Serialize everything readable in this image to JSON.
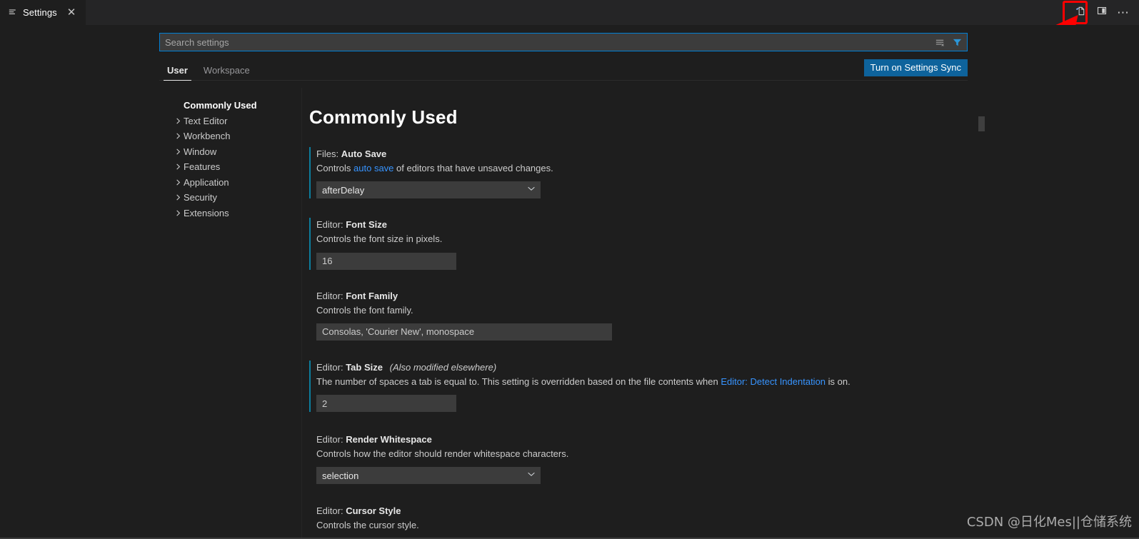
{
  "window": {
    "tab": {
      "title": "Settings",
      "icon": "settings-list-icon",
      "close_label": "✕"
    },
    "actions": [
      {
        "name": "open-settings-json-button",
        "icon": "file-json-icon",
        "label": ""
      },
      {
        "name": "split-editor-button",
        "icon": "split-editor-icon",
        "label": ""
      },
      {
        "name": "more-actions-button",
        "icon": "ellipsis-icon",
        "label": "⋯"
      }
    ]
  },
  "annotation": {
    "box_color": "#fe0000",
    "arrow_color": "#fe0000",
    "target": "open-settings-json-button"
  },
  "search": {
    "placeholder": "Search settings",
    "value": "",
    "clear_icon": "clear-settings-search-icon",
    "filter_icon": "filter-funnel-icon",
    "border_color": "#007fd4"
  },
  "tabs": {
    "items": [
      {
        "label": "User",
        "active": true
      },
      {
        "label": "Workspace",
        "active": false
      }
    ],
    "sync_button": {
      "label": "Turn on Settings Sync",
      "color": "#0e639c"
    }
  },
  "toc": {
    "items": [
      {
        "label": "Commonly Used",
        "expandable": false,
        "selected": true
      },
      {
        "label": "Text Editor",
        "expandable": true,
        "selected": false
      },
      {
        "label": "Workbench",
        "expandable": true,
        "selected": false
      },
      {
        "label": "Window",
        "expandable": true,
        "selected": false
      },
      {
        "label": "Features",
        "expandable": true,
        "selected": false
      },
      {
        "label": "Application",
        "expandable": true,
        "selected": false
      },
      {
        "label": "Security",
        "expandable": true,
        "selected": false
      },
      {
        "label": "Extensions",
        "expandable": true,
        "selected": false
      }
    ]
  },
  "main": {
    "heading": "Commonly Used",
    "modified_accent": "#0c7d9d",
    "settings": [
      {
        "category": "Files:",
        "name": "Auto Save",
        "overridden_note": "",
        "desc_pre": "Controls ",
        "desc_link": "auto save",
        "desc_post": " of editors that have unsaved changes.",
        "control": "select",
        "value": "afterDelay",
        "modified": true
      },
      {
        "category": "Editor:",
        "name": "Font Size",
        "overridden_note": "",
        "desc_pre": "Controls the font size in pixels.",
        "desc_link": "",
        "desc_post": "",
        "control": "text",
        "value": "16",
        "modified": true
      },
      {
        "category": "Editor:",
        "name": "Font Family",
        "overridden_note": "",
        "desc_pre": "Controls the font family.",
        "desc_link": "",
        "desc_post": "",
        "control": "text-wide",
        "value": "Consolas, 'Courier New', monospace",
        "modified": false
      },
      {
        "category": "Editor:",
        "name": "Tab Size",
        "overridden_note": "(Also modified elsewhere)",
        "desc_pre": "The number of spaces a tab is equal to. This setting is overridden based on the file contents when ",
        "desc_link": "Editor: Detect Indentation",
        "desc_post": " is on.",
        "control": "text",
        "value": "2",
        "modified": true
      },
      {
        "category": "Editor:",
        "name": "Render Whitespace",
        "overridden_note": "",
        "desc_pre": "Controls how the editor should render whitespace characters.",
        "desc_link": "",
        "desc_post": "",
        "control": "select",
        "value": "selection",
        "modified": false
      },
      {
        "category": "Editor:",
        "name": "Cursor Style",
        "overridden_note": "",
        "desc_pre": "Controls the cursor style.",
        "desc_link": "",
        "desc_post": "",
        "control": "none",
        "value": "",
        "modified": false
      }
    ]
  },
  "watermark": {
    "text": "CSDN @日化Mes||仓储系统"
  }
}
